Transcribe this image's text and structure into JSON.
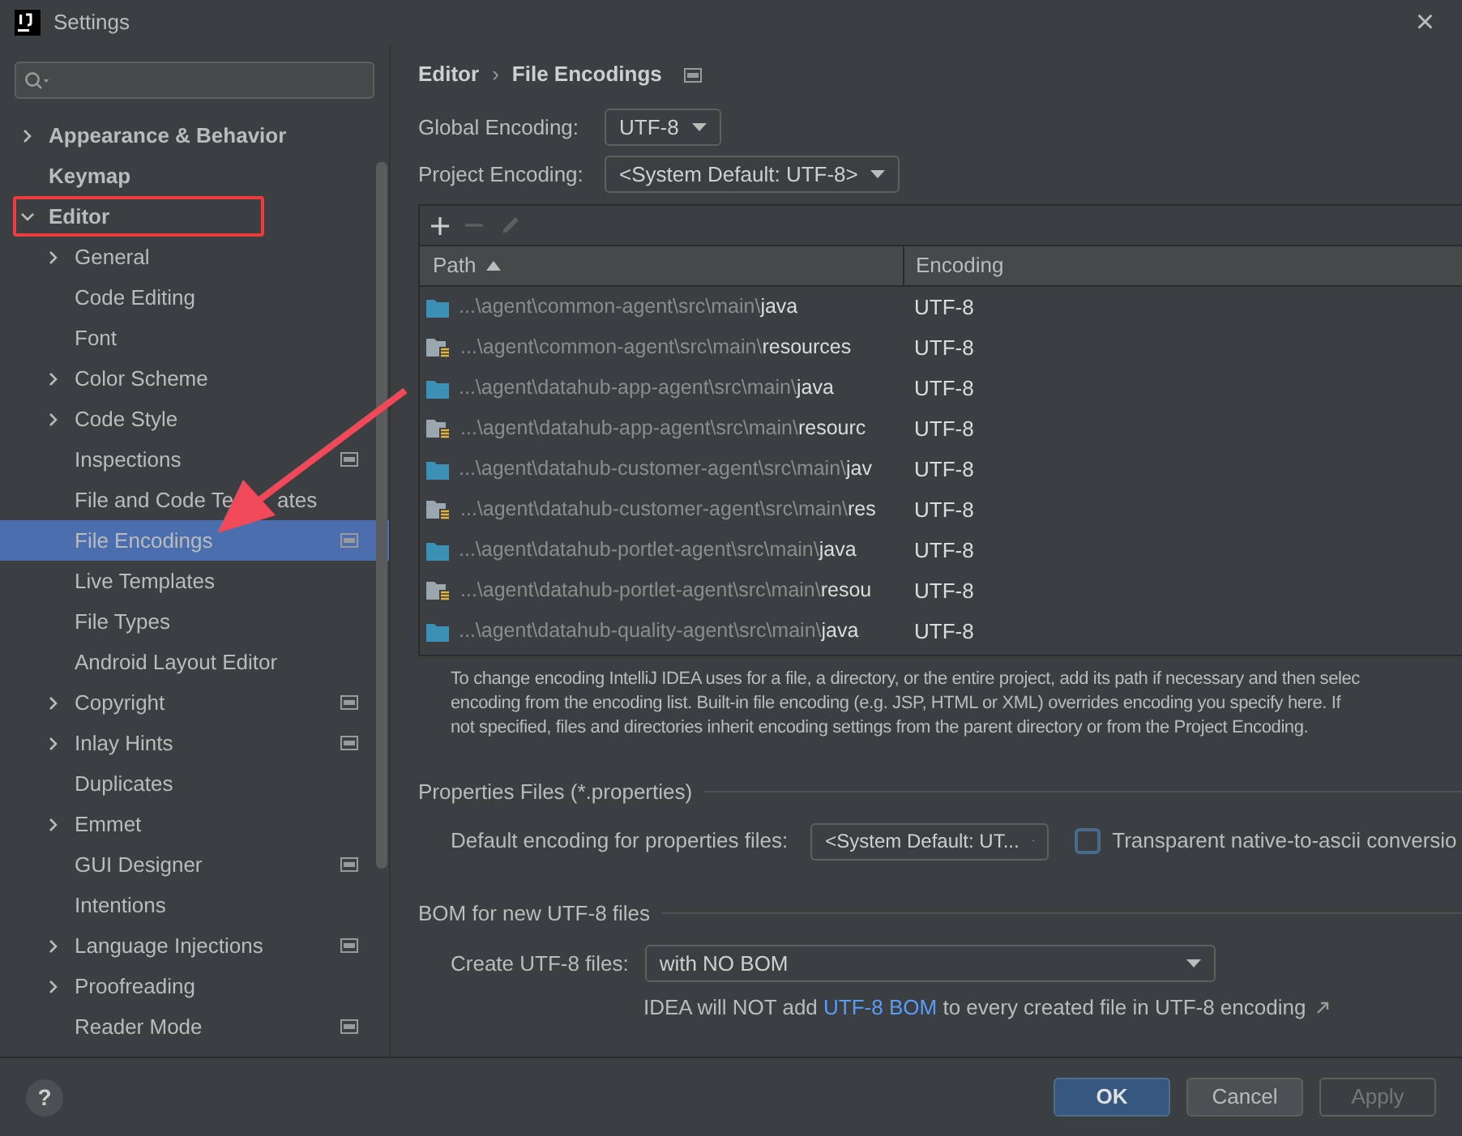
{
  "window": {
    "title": "Settings",
    "close": "×"
  },
  "sidebar": {
    "items": [
      {
        "label": "Appearance & Behavior",
        "bold": true,
        "expanded": false,
        "selected": false,
        "project_icon": false,
        "highlighted": false
      },
      {
        "label": "Keymap",
        "bold": true,
        "selected": false,
        "project_icon": false,
        "highlighted": false
      },
      {
        "label": "Editor",
        "bold": true,
        "expanded": true,
        "selected": false,
        "project_icon": false,
        "highlighted": true,
        "children": [
          {
            "label": "General",
            "expanded": false,
            "selected": false,
            "project_icon": false
          },
          {
            "label": "Code Editing",
            "selected": false,
            "project_icon": false
          },
          {
            "label": "Font",
            "selected": false,
            "project_icon": false
          },
          {
            "label": "Color Scheme",
            "expanded": false,
            "selected": false,
            "project_icon": false
          },
          {
            "label": "Code Style",
            "expanded": false,
            "selected": false,
            "project_icon": false
          },
          {
            "label": "Inspections",
            "selected": false,
            "project_icon": true
          },
          {
            "label": "File and Code Te",
            "label_tail": "ates",
            "selected": false,
            "project_icon": false
          },
          {
            "label": "File Encodings",
            "selected": true,
            "project_icon": true
          },
          {
            "label": "Live Templates",
            "selected": false,
            "project_icon": false
          },
          {
            "label": "File Types",
            "selected": false,
            "project_icon": false
          },
          {
            "label": "Android Layout Editor",
            "selected": false,
            "project_icon": false
          },
          {
            "label": "Copyright",
            "expanded": false,
            "selected": false,
            "project_icon": true
          },
          {
            "label": "Inlay Hints",
            "expanded": false,
            "selected": false,
            "project_icon": true
          },
          {
            "label": "Duplicates",
            "selected": false,
            "project_icon": false
          },
          {
            "label": "Emmet",
            "expanded": false,
            "selected": false,
            "project_icon": false
          },
          {
            "label": "GUI Designer",
            "selected": false,
            "project_icon": true
          },
          {
            "label": "Intentions",
            "selected": false,
            "project_icon": false
          },
          {
            "label": "Language Injections",
            "expanded": false,
            "selected": false,
            "project_icon": true
          },
          {
            "label": "Proofreading",
            "expanded": false,
            "selected": false,
            "project_icon": false
          },
          {
            "label": "Reader Mode",
            "selected": false,
            "project_icon": true
          }
        ]
      }
    ]
  },
  "breadcrumb": [
    "Editor",
    "File Encodings"
  ],
  "breadcrumb_separator": "›",
  "global_encoding": {
    "label": "Global Encoding:",
    "value": "UTF-8"
  },
  "project_encoding": {
    "label": "Project Encoding:",
    "value": "<System Default: UTF-8>"
  },
  "table": {
    "columns": [
      "Path",
      "Encoding"
    ],
    "rows": [
      {
        "kind": "source",
        "dir": "...\\agent\\common-agent\\src\\main\\",
        "name": "java",
        "encoding": "UTF-8"
      },
      {
        "kind": "resources",
        "dir": "...\\agent\\common-agent\\src\\main\\",
        "name": "resources",
        "encoding": "UTF-8"
      },
      {
        "kind": "source",
        "dir": "...\\agent\\datahub-app-agent\\src\\main\\",
        "name": "java",
        "encoding": "UTF-8"
      },
      {
        "kind": "resources",
        "dir": "...\\agent\\datahub-app-agent\\src\\main\\",
        "name": "resourc",
        "encoding": "UTF-8"
      },
      {
        "kind": "source",
        "dir": "...\\agent\\datahub-customer-agent\\src\\main\\",
        "name": "jav",
        "encoding": "UTF-8"
      },
      {
        "kind": "resources",
        "dir": "...\\agent\\datahub-customer-agent\\src\\main\\",
        "name": "res",
        "encoding": "UTF-8"
      },
      {
        "kind": "source",
        "dir": "...\\agent\\datahub-portlet-agent\\src\\main\\",
        "name": "java",
        "encoding": "UTF-8"
      },
      {
        "kind": "resources",
        "dir": "...\\agent\\datahub-portlet-agent\\src\\main\\",
        "name": "resou",
        "encoding": "UTF-8"
      },
      {
        "kind": "source",
        "dir": "...\\agent\\datahub-quality-agent\\src\\main\\",
        "name": "java",
        "encoding": "UTF-8"
      }
    ]
  },
  "description": [
    "To change encoding IntelliJ IDEA uses for a file, a directory, or the entire project, add its path if necessary and then selec",
    "encoding from the encoding list. Built-in file encoding (e.g. JSP, HTML or XML) overrides encoding you specify here. If",
    "not specified, files and directories inherit encoding settings from the parent directory or from the Project Encoding."
  ],
  "properties": {
    "title": "Properties Files (*.properties)",
    "label": "Default encoding for properties files:",
    "value": "<System Default: UT...",
    "checkbox": {
      "label": "Transparent native-to-ascii conversio",
      "checked": false
    }
  },
  "bom": {
    "title": "BOM for new UTF-8 files",
    "label": "Create UTF-8 files:",
    "value": "with NO BOM",
    "note_before": "IDEA will NOT add ",
    "note_link": "UTF-8 BOM",
    "note_after": " to every created file in UTF-8 encoding"
  },
  "help": "?",
  "buttons": [
    {
      "label": "OK",
      "kind": "primary"
    },
    {
      "label": "Cancel",
      "kind": "normal"
    },
    {
      "label": "Apply",
      "kind": "disabled"
    }
  ],
  "pointer_arrow": true
}
